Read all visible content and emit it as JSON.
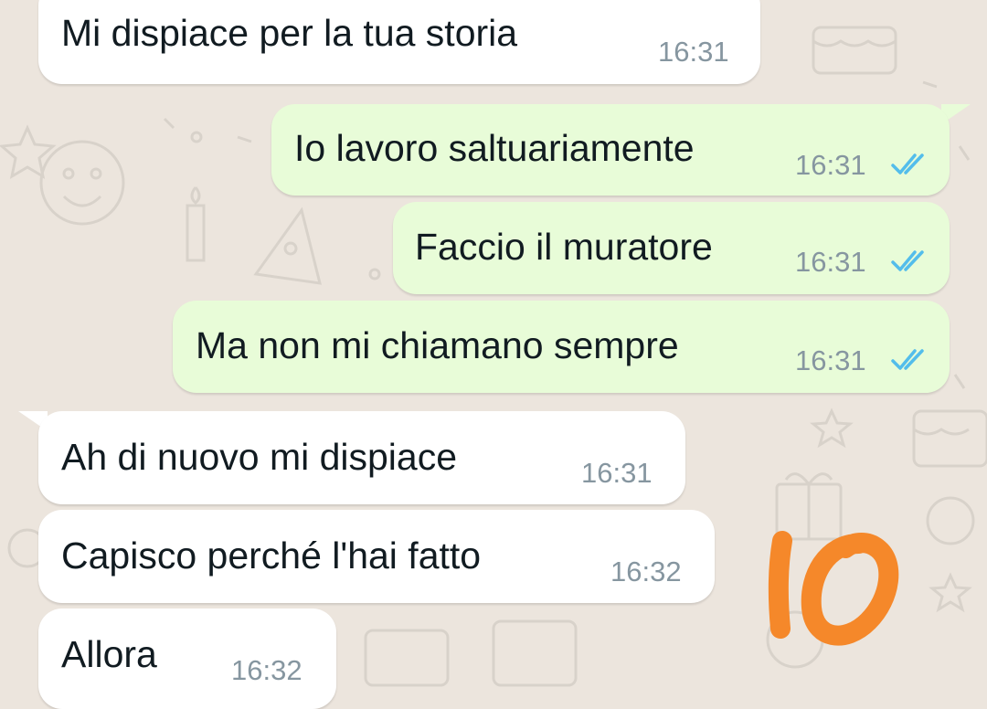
{
  "messages": [
    {
      "direction": "incoming",
      "text": "Mi dispiace per la tua storia",
      "time": "16:31"
    },
    {
      "direction": "outgoing",
      "text": "Io lavoro saltuariamente",
      "time": "16:31",
      "status": "read"
    },
    {
      "direction": "outgoing",
      "text": "Faccio il muratore",
      "time": "16:31",
      "status": "read"
    },
    {
      "direction": "outgoing",
      "text": "Ma non mi chiamano sempre",
      "time": "16:31",
      "status": "read"
    },
    {
      "direction": "incoming",
      "text": "Ah di nuovo mi dispiace",
      "time": "16:31"
    },
    {
      "direction": "incoming",
      "text": "Capisco perché l'hai fatto",
      "time": "16:32"
    },
    {
      "direction": "incoming",
      "text": "Allora",
      "time": "16:32"
    }
  ],
  "colors": {
    "chat_background": "#ece5dd",
    "incoming_bubble": "#ffffff",
    "outgoing_bubble": "#e8fcd8",
    "read_ticks": "#53bdeb",
    "timestamp": "#8696a0",
    "annotation": "#f5882a"
  },
  "icons": {
    "read_receipt": "double-check-icon"
  },
  "annotation": {
    "description": "orange hand-drawn scribble"
  }
}
